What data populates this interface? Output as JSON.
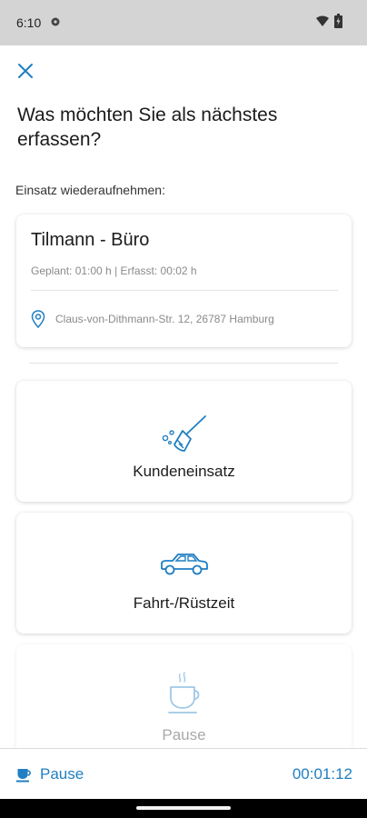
{
  "status_bar": {
    "time": "6:10",
    "icons": [
      "settings-gear-icon",
      "wifi-icon",
      "battery-icon"
    ]
  },
  "header": {
    "close_icon": "close-icon",
    "title": "Was möchten Sie als nächstes erfassen?"
  },
  "resume_section": {
    "label": "Einsatz wiederaufnehmen:",
    "card": {
      "title": "Tilmann - Büro",
      "meta": "Geplant: 01:00 h | Erfasst: 00:02 h",
      "address_icon": "location-pin-icon",
      "address": "Claus-von-Dithmann-Str. 12, 26787 Hamburg"
    }
  },
  "options": [
    {
      "label": "Kundeneinsatz",
      "icon": "broom-icon"
    },
    {
      "label": "Fahrt-/Rüstzeit",
      "icon": "car-icon"
    },
    {
      "label": "Pause",
      "icon": "coffee-cup-icon"
    }
  ],
  "bottom_bar": {
    "pause_label": "Pause",
    "pause_icon": "coffee-cup-icon",
    "timer": "00:01:12"
  },
  "colors": {
    "accent": "#1f7fc2",
    "status_bar": "#d4d4d4",
    "muted_text": "#8a8a8a"
  }
}
